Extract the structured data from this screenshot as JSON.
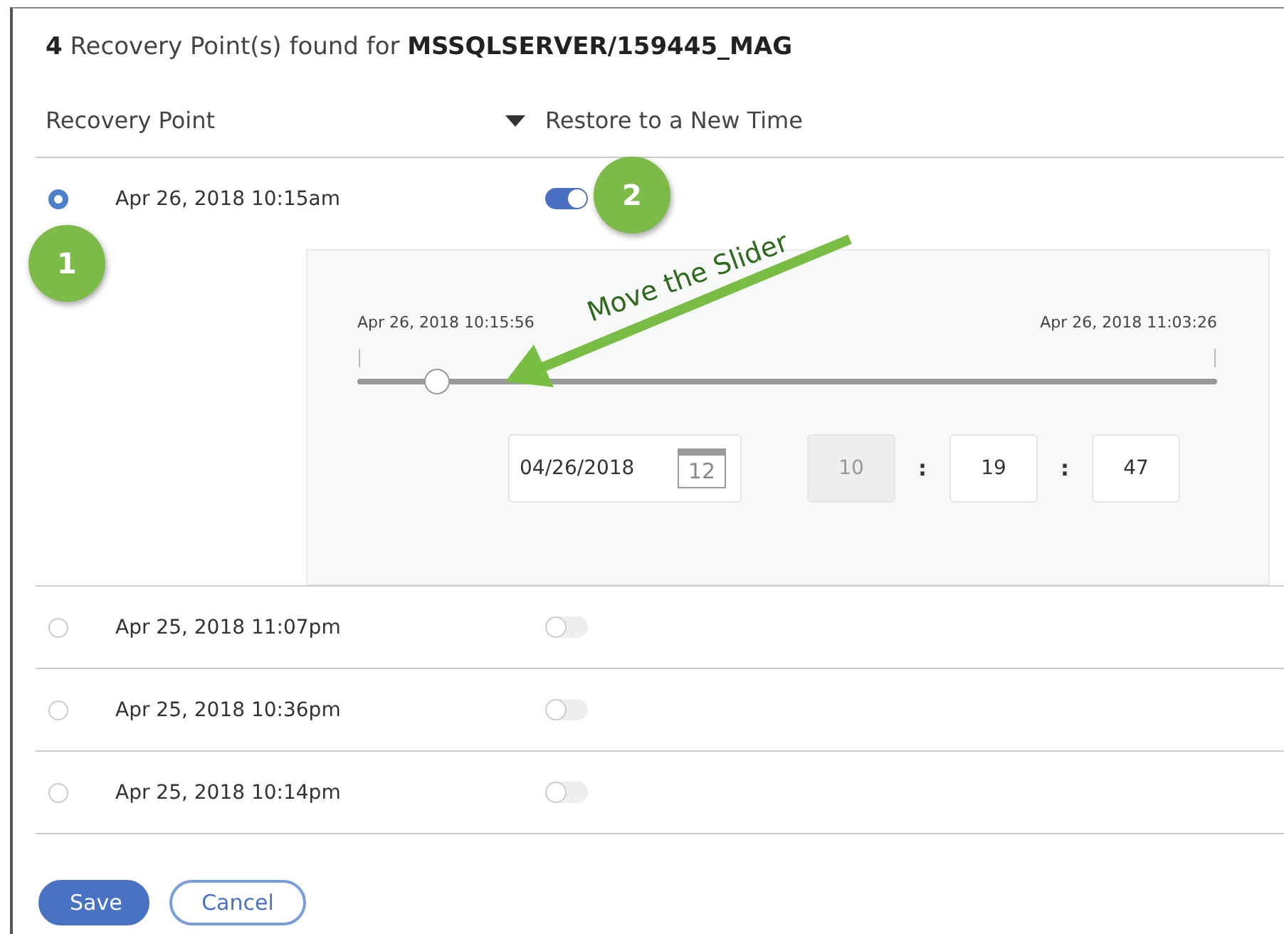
{
  "title": "**4** Recovery Point(s) found for **MSSQLSERVER/159445_MAG**",
  "columns": [
    "Recovery Point",
    "Restore to a New Time"
  ],
  "rows": [
    {
      "time": "Apr 26, 2018 10:15am",
      "selected": true,
      "restore_new_time": true,
      "expanded": true
    },
    {
      "time": "Apr 25, 2018 11:07pm",
      "selected": false,
      "restore_new_time": false,
      "expanded": false
    },
    {
      "time": "Apr 25, 2018 10:36pm",
      "selected": false,
      "restore_new_time": false,
      "expanded": false
    },
    {
      "time": "Apr 25, 2018 10:14pm",
      "selected": false,
      "restore_new_time": false,
      "expanded": false
    }
  ],
  "time_picker": {
    "range_start": "Apr 26, 2018 10:15:56",
    "range_end": "Apr 26, 2018 11:03:26",
    "level": 0.093,
    "date": "04/26/2018",
    "calendar_day": "12",
    "hour": "10",
    "hour_disabled": true,
    "minute": "19",
    "second": "47",
    "separator": ":"
  },
  "buttons": [
    {
      "label": "Save",
      "kind": "primary"
    },
    {
      "label": "Cancel",
      "kind": "secondary"
    }
  ],
  "annotations": [
    {
      "kind": "step",
      "label": "1"
    },
    {
      "kind": "step",
      "label": "2"
    },
    {
      "kind": "arrow",
      "label": "Move the Slider"
    }
  ]
}
